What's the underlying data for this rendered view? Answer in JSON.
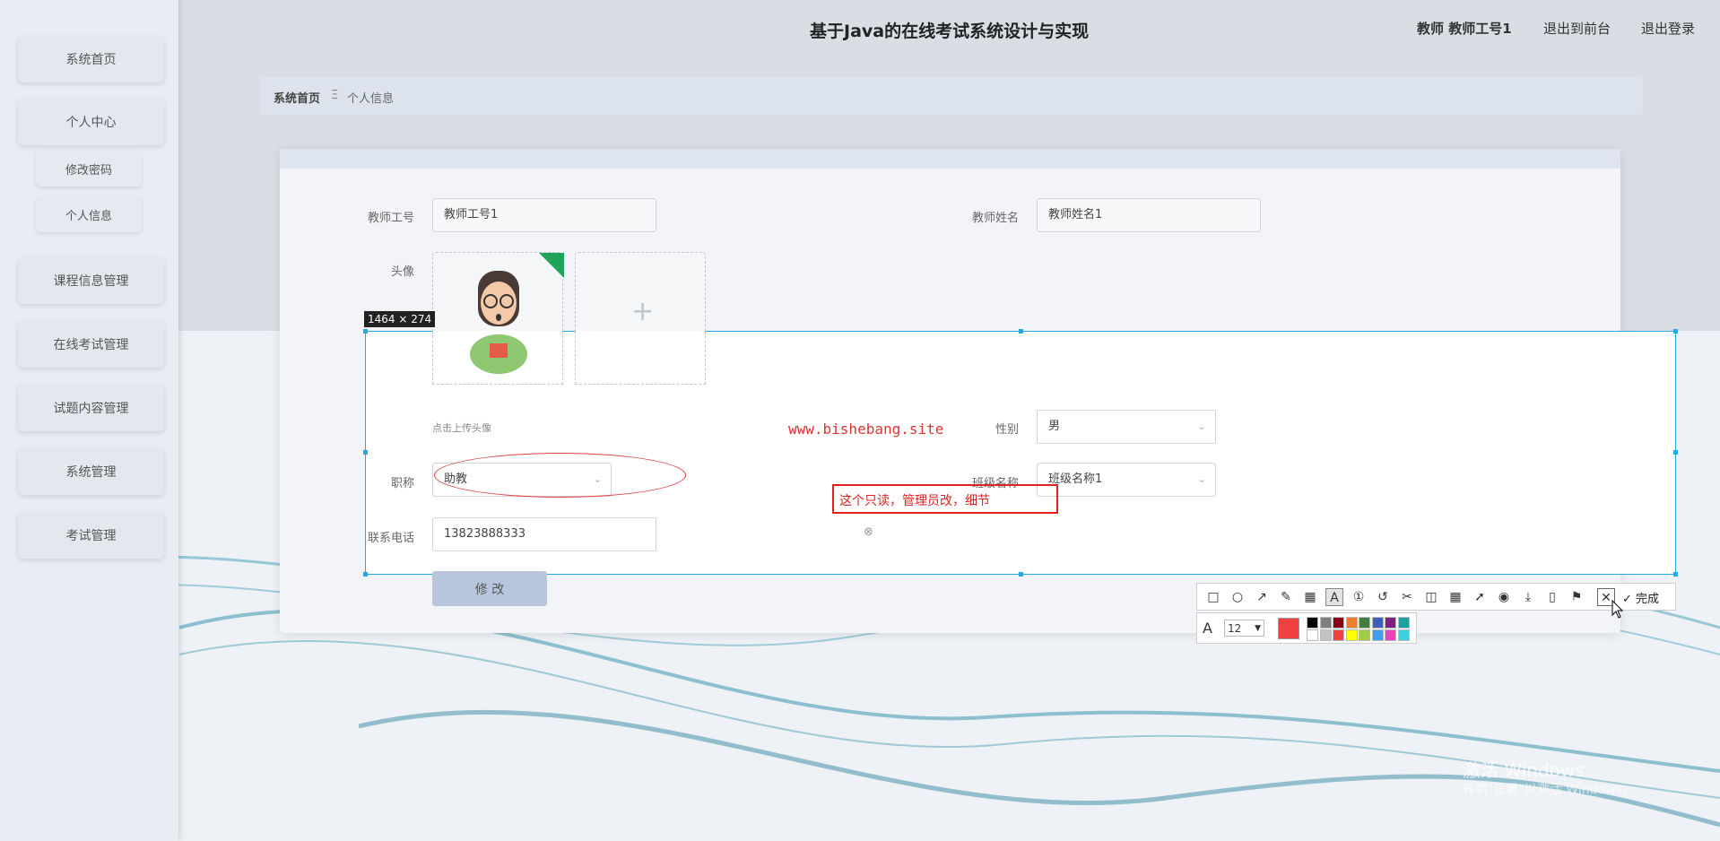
{
  "header": {
    "title": "基于Java的在线考试系统设计与实现",
    "user": "教师 教师工号1",
    "front_link": "退出到前台",
    "logout": "退出登录"
  },
  "sidebar": {
    "items": [
      {
        "label": "系统首页"
      },
      {
        "label": "个人中心"
      },
      {
        "label": "修改密码"
      },
      {
        "label": "个人信息"
      },
      {
        "label": "课程信息管理"
      },
      {
        "label": "在线考试管理"
      },
      {
        "label": "试题内容管理"
      },
      {
        "label": "系统管理"
      },
      {
        "label": "考试管理"
      }
    ]
  },
  "breadcrumb": {
    "home": "系统首页",
    "separator": "Ξ",
    "current": "个人信息"
  },
  "form": {
    "teacher_id_label": "教师工号",
    "teacher_id_value": "教师工号1",
    "teacher_name_label": "教师姓名",
    "teacher_name_value": "教师姓名1",
    "avatar_label": "头像",
    "upload_hint": "点击上传头像",
    "gender_label": "性别",
    "gender_value": "男",
    "title_label": "职称",
    "title_value": "助教",
    "class_label": "班级名称",
    "class_value": "班级名称1",
    "phone_label": "联系电话",
    "phone_value": "13823888333",
    "submit": "修 改"
  },
  "screenshot_tool": {
    "dimensions": "1464 × 274",
    "watermark": "www.bishebang.site",
    "note": "这个只读，管理员改，细节",
    "done": "完成",
    "font_size": "12",
    "selected_color": "#f04040",
    "palette": [
      "#000000",
      "#7f7f7f",
      "#880015",
      "#ed7d31",
      "#3f7f3f",
      "#3f5fbf",
      "#7f1f7f",
      "#1f9f9f",
      "#ffffff",
      "#c3c3c3",
      "#f04040",
      "#ffff00",
      "#9fcf3f",
      "#3f9fef",
      "#ef3fbf",
      "#3fcfdf"
    ]
  },
  "windows": {
    "activate": "激活 Windows",
    "activate_hint": "转到\"设置\"以激活 Windows。"
  },
  "colors": {
    "selection_border": "#2aa6e0",
    "annotation_red": "#d22222",
    "accent": "#b7c6dc"
  }
}
